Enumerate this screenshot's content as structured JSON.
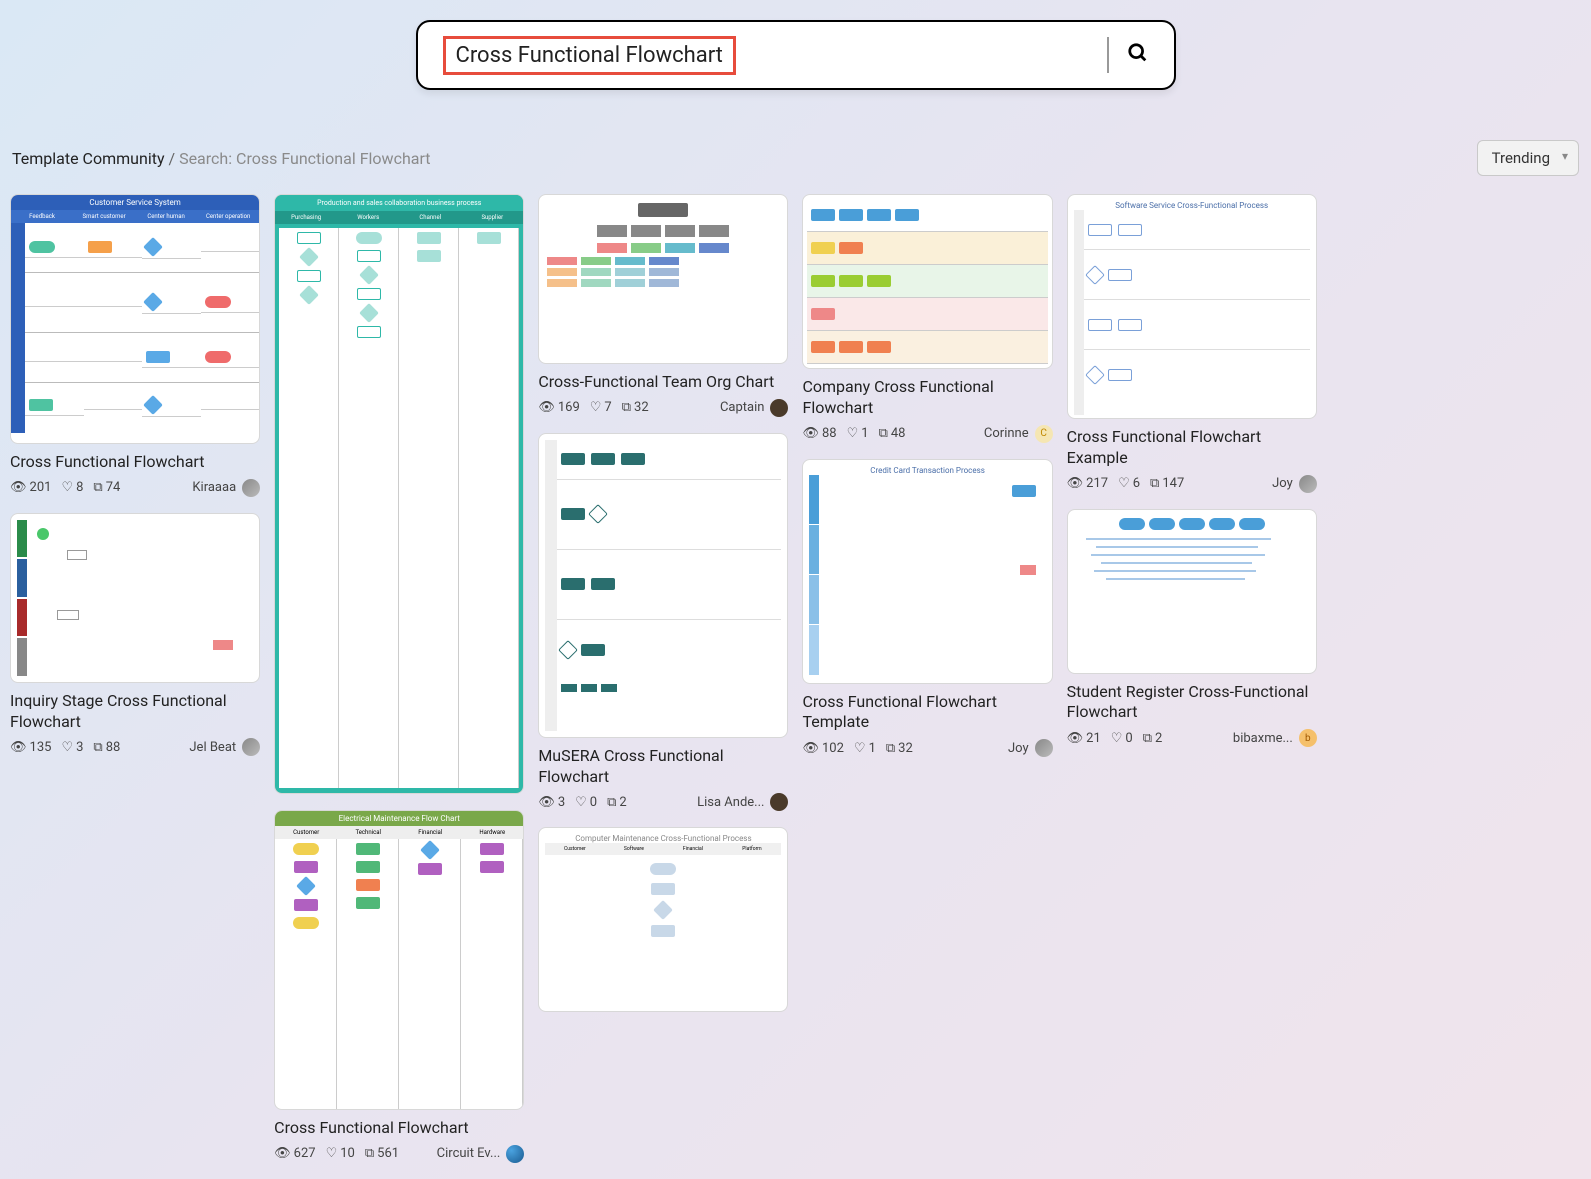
{
  "search": {
    "query": "Cross Functional Flowchart"
  },
  "breadcrumb": {
    "root": "Template Community",
    "sep": "/",
    "current": "Search: Cross Functional Flowchart"
  },
  "sort": {
    "label": "Trending"
  },
  "cards": [
    {
      "title": "Cross Functional Flowchart",
      "views": "201",
      "likes": "8",
      "copies": "74",
      "author": "Kiraaaa",
      "avatar_class": ""
    },
    {
      "title": "Inquiry Stage Cross Functional Flowchart",
      "views": "135",
      "likes": "3",
      "copies": "88",
      "author": "Jel Beat",
      "avatar_class": ""
    },
    {
      "title": "Cross Functional Flowchart",
      "views": "627",
      "likes": "10",
      "copies": "561",
      "author": "Circuit Ev...",
      "avatar_class": "blue"
    },
    {
      "title": "Cross-Functional Team Org Chart",
      "views": "169",
      "likes": "7",
      "copies": "32",
      "author": "Captain",
      "avatar_class": "dark"
    },
    {
      "title": "MuSERA Cross Functional Flowchart",
      "views": "3",
      "likes": "0",
      "copies": "2",
      "author": "Lisa Ande...",
      "avatar_class": "dark"
    },
    {
      "title": "Company Cross Functional Flowchart",
      "views": "88",
      "likes": "1",
      "copies": "48",
      "author": "Corinne",
      "avatar_class": "c",
      "avatar_letter": "C"
    },
    {
      "title": "Cross Functional Flowchart Template",
      "views": "102",
      "likes": "1",
      "copies": "32",
      "author": "Joy",
      "avatar_class": ""
    },
    {
      "title": "Cross Functional Flowchart Example",
      "views": "217",
      "likes": "6",
      "copies": "147",
      "author": "Joy",
      "avatar_class": ""
    },
    {
      "title": "Student Register Cross-Functional Flowchart",
      "views": "21",
      "likes": "0",
      "copies": "2",
      "author": "bibaxme...",
      "avatar_class": "b",
      "avatar_letter": "b"
    }
  ],
  "thumb_titles": {
    "t0": "Customer Service System",
    "t2": "Electrical Maintenance Flow Chart",
    "t5_h": "Computer Maintenance Cross-Functional Process",
    "t7": "Software Service Cross-Functional Process",
    "t6_h": "Credit Card Transaction Process"
  }
}
